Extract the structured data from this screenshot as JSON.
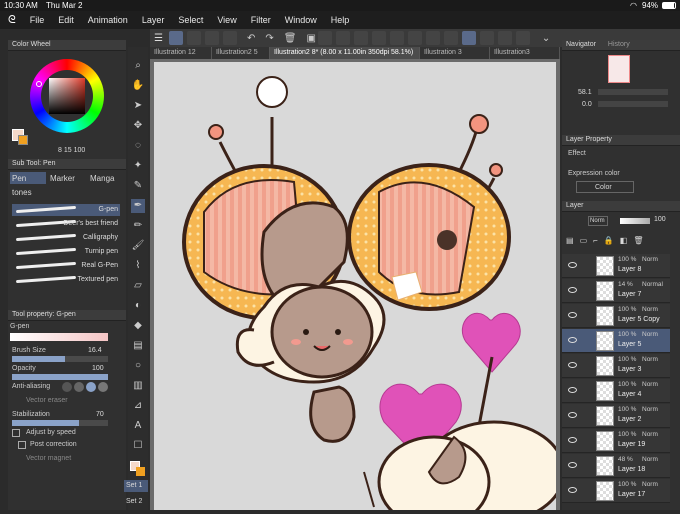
{
  "status": {
    "time": "10:30 AM",
    "date": "Thu Mar 2",
    "battery": "94%"
  },
  "menu": [
    "File",
    "Edit",
    "Animation",
    "Layer",
    "Select",
    "View",
    "Filter",
    "Window",
    "Help"
  ],
  "tabs": [
    "Illustration 12",
    "Illustration2 5",
    "Illustration2 8* (8.00 x 11.00in 350dpi 58.1%)",
    "Illustration 3",
    "Illustration3"
  ],
  "left": {
    "color_wheel": {
      "title": "Color Wheel",
      "h": "8",
      "s": "15",
      "v": "100",
      "accent": "#e85a3a"
    },
    "subtool": {
      "title": "Sub Tool: Pen",
      "tabs": [
        "Pen",
        "Marker",
        "Manga"
      ],
      "group": "tones"
    },
    "brushes": [
      "G-pen",
      "Deer's best friend",
      "Calligraphy",
      "Turnip pen",
      "Real G-Pen",
      "Textured pen"
    ],
    "toolprop": {
      "title": "Tool property: G-pen",
      "name": "G-pen",
      "brush_size_label": "Brush Size",
      "brush_size": "16.4",
      "brush_size_fraction": 0.55,
      "opacity_label": "Opacity",
      "opacity": "100",
      "opacity_fraction": 1.0,
      "aa_label": "Anti-aliasing",
      "vector_eraser": "Vector eraser",
      "stabilization_label": "Stabilization",
      "stabilization": "70",
      "stabilization_fraction": 0.7,
      "adjust_speed": "Adjust by speed",
      "post_correction": "Post correction",
      "vector_magnet": "Vector magnet"
    },
    "sets": [
      "Set 1",
      "Set 2"
    ]
  },
  "right": {
    "navigator": {
      "title": "Navigator",
      "history": "History",
      "zoom": "58.1",
      "rotation": "0.0"
    },
    "layer_property": {
      "title": "Layer Property",
      "effect": "Effect",
      "expression_color": "Expression color",
      "color_mode": "Color"
    },
    "layer_panel": {
      "title": "Layer",
      "blend": "Norm",
      "opacity": "100"
    },
    "layers": [
      {
        "percent": "100 %",
        "mode": "Norm",
        "name": "Layer 8"
      },
      {
        "percent": "14 %",
        "mode": "Normal",
        "name": "Layer 7"
      },
      {
        "percent": "100 %",
        "mode": "Norm",
        "name": "Layer 5 Copy"
      },
      {
        "percent": "100 %",
        "mode": "Norm",
        "name": "Layer 5"
      },
      {
        "percent": "100 %",
        "mode": "Norm",
        "name": "Layer 3"
      },
      {
        "percent": "100 %",
        "mode": "Norm",
        "name": "Layer 4"
      },
      {
        "percent": "100 %",
        "mode": "Norm",
        "name": "Layer 2"
      },
      {
        "percent": "100 %",
        "mode": "Norm",
        "name": "Layer 19"
      },
      {
        "percent": "48 %",
        "mode": "Norm",
        "name": "Layer 18"
      },
      {
        "percent": "100 %",
        "mode": "Norm",
        "name": "Layer 17"
      }
    ]
  },
  "colors": {
    "selected_layer": "#4a5a78",
    "main": "#f5d9c9",
    "sub": "#f0a020"
  }
}
